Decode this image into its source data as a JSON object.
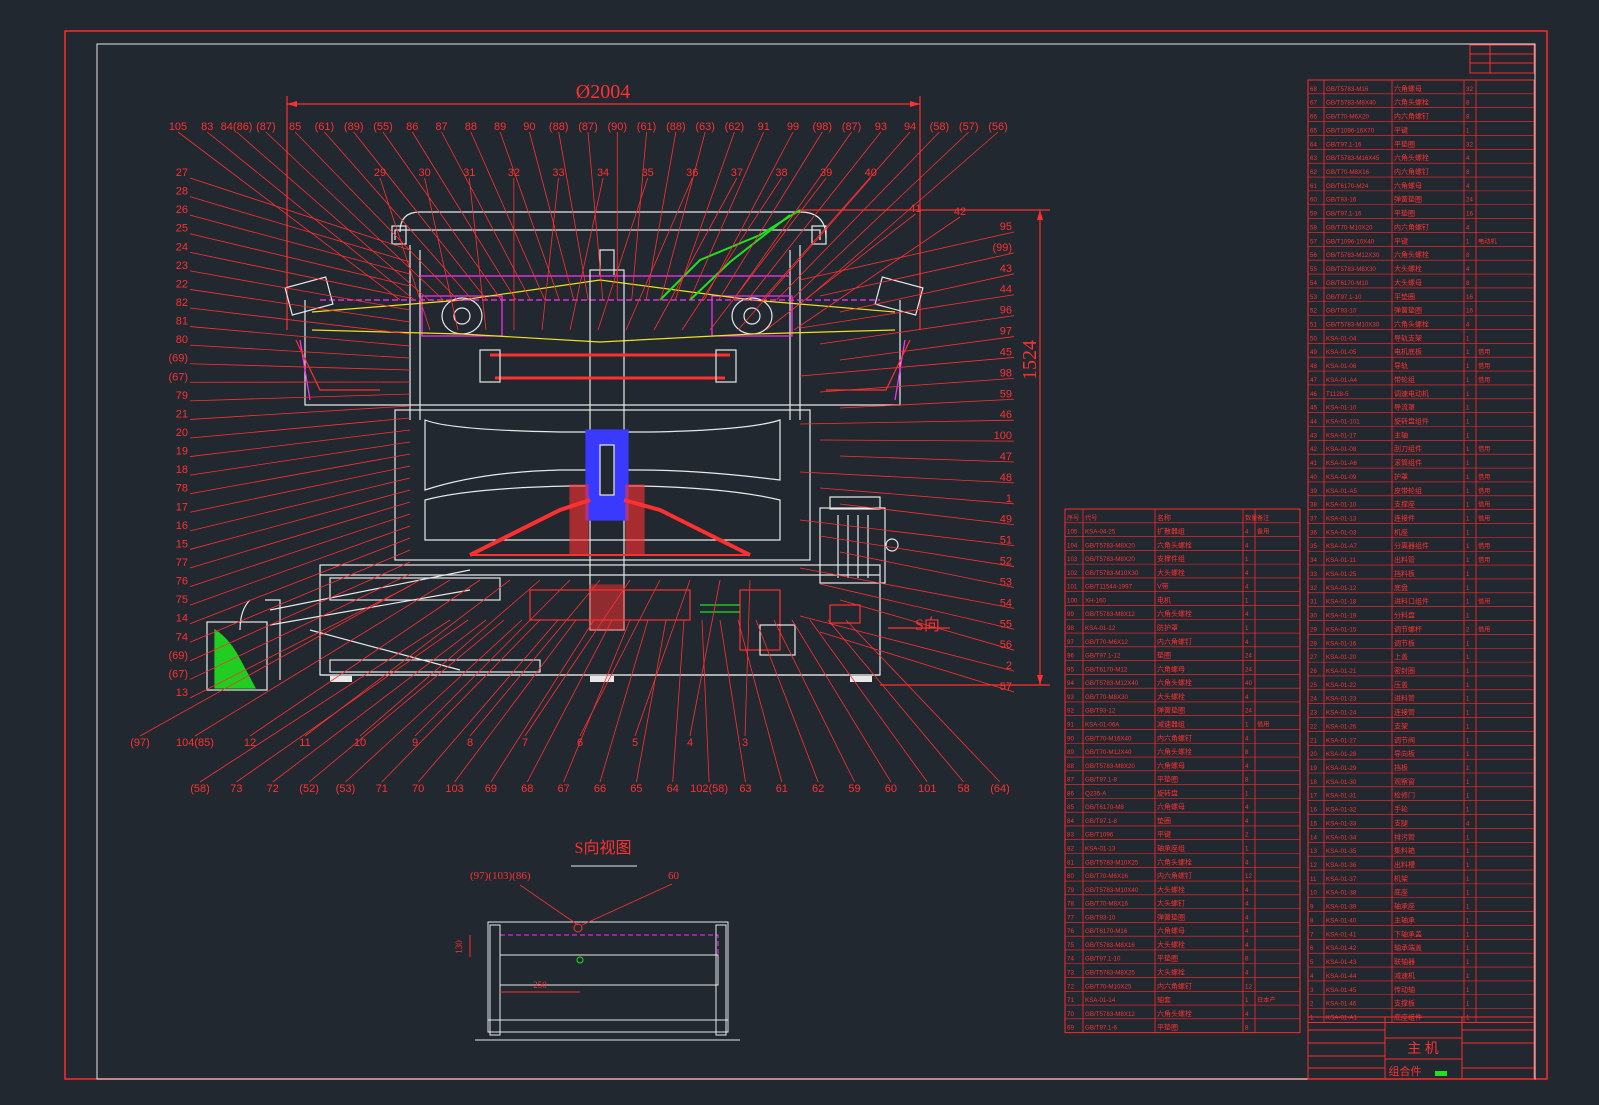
{
  "drawing": {
    "dimension_width": "Ø2004",
    "dimension_height": "1524",
    "section_marker": "S向",
    "view_title": "S向视图",
    "view_callouts": [
      "(97)(103)(86)",
      "60"
    ],
    "view_dim_height": "130",
    "view_dim_width": "250",
    "title_block_name": "主 机",
    "title_block_type": "组合件"
  },
  "callouts_top": [
    "105",
    "83",
    "84(86)",
    "(87)",
    "85",
    "(61)",
    "(89)",
    "(55)",
    "86",
    "87",
    "88",
    "89",
    "90",
    "(88)",
    "(87)",
    "(90)",
    "(61)",
    "(88)",
    "(63)",
    "(62)",
    "91",
    "99",
    "(98)",
    "(87)",
    "93",
    "94",
    "(58)",
    "(57)",
    "(56)"
  ],
  "callouts_upper_row": [
    "29",
    "30",
    "31",
    "32",
    "33",
    "34",
    "35",
    "36",
    "37",
    "38",
    "39",
    "40",
    "41",
    "42"
  ],
  "callouts_left": [
    "27",
    "28",
    "26",
    "25",
    "24",
    "23",
    "22",
    "82",
    "81",
    "80",
    "(69)",
    "(67)",
    "79",
    "21",
    "20",
    "19",
    "18",
    "78",
    "17",
    "16",
    "15",
    "77",
    "76",
    "75",
    "14",
    "74",
    "(69)",
    "(67)",
    "13"
  ],
  "callouts_right": [
    "95",
    "(99)",
    "43",
    "44",
    "96",
    "97",
    "45",
    "98",
    "59",
    "46",
    "100",
    "47",
    "48",
    "1",
    "49",
    "51",
    "52",
    "53",
    "54",
    "55",
    "56",
    "2",
    "57"
  ],
  "callouts_bottom": [
    "(97)",
    "104(85)",
    "12",
    "11",
    "10",
    "9",
    "8",
    "7",
    "6",
    "5",
    "4",
    "3",
    "(58)",
    "73",
    "72",
    "(52)",
    "(53)",
    "71",
    "70",
    "103",
    "69",
    "68",
    "67",
    "66",
    "65",
    "64",
    "102(58)",
    "63",
    "61",
    "62",
    "59",
    "60",
    "101",
    "58",
    "(64)"
  ],
  "parts_list_header": [
    "序号",
    "代号",
    "名称",
    "数量",
    "备注"
  ],
  "parts_list_mid": [
    [
      "105",
      "KSA-04-25",
      "扩散器组",
      "4",
      "备用"
    ],
    [
      "104",
      "GB/T5783-M8X20",
      "六角头螺栓",
      "4",
      ""
    ],
    [
      "103",
      "GB/T5783-M8X20",
      "支撑件组",
      "1",
      ""
    ],
    [
      "102",
      "GB/T5783-M10X30",
      "大头螺栓",
      "4",
      ""
    ],
    [
      "101",
      "GB/T11544-1997",
      "V带",
      "4",
      ""
    ],
    [
      "100",
      "XH-160",
      "电机",
      "1",
      ""
    ],
    [
      "99",
      "GB/T5783-M8X12",
      "六角头螺栓",
      "4",
      ""
    ],
    [
      "98",
      "KSA-01-12",
      "防护罩",
      "1",
      ""
    ],
    [
      "97",
      "GB/T70-M6X12",
      "内六角螺钉",
      "4",
      ""
    ],
    [
      "96",
      "GB/T97.1-12",
      "垫圈",
      "24",
      ""
    ],
    [
      "95",
      "GB/T6170-M12",
      "六角螺母",
      "24",
      ""
    ],
    [
      "94",
      "GB/T5783-M12X40",
      "六角头螺栓",
      "40",
      ""
    ],
    [
      "93",
      "GB/T70-M8X30",
      "大头螺栓",
      "4",
      ""
    ],
    [
      "92",
      "GB/T93-12",
      "弹簧垫圈",
      "24",
      ""
    ],
    [
      "91",
      "KSA-01-06A",
      "减速器组",
      "1",
      "借用"
    ],
    [
      "90",
      "GB/T70-M16X40",
      "内六角螺钉",
      "4",
      ""
    ],
    [
      "89",
      "GB/T70-M12X40",
      "六角头螺栓",
      "8",
      ""
    ],
    [
      "88",
      "GB/T5783-M8X20",
      "六角螺母",
      "4",
      ""
    ],
    [
      "87",
      "GB/T97.1-8",
      "平垫圈",
      "8",
      ""
    ],
    [
      "86",
      "Q235-A",
      "旋转盘",
      "1",
      ""
    ],
    [
      "85",
      "GB/T6170-M8",
      "六角螺母",
      "4",
      ""
    ],
    [
      "84",
      "GB/T97.1-8",
      "垫圈",
      "4",
      ""
    ],
    [
      "83",
      "GB/T1096",
      "平键",
      "2",
      ""
    ],
    [
      "82",
      "KSA-01-13",
      "轴承座组",
      "1",
      ""
    ],
    [
      "81",
      "GB/T5783-M10X25",
      "六角头螺栓",
      "4",
      ""
    ],
    [
      "80",
      "GB/T70-M6X16",
      "内六角螺钉",
      "12",
      ""
    ],
    [
      "79",
      "GB/T5783-M10X40",
      "大头螺栓",
      "4",
      ""
    ],
    [
      "78",
      "GB/T70-M8X16",
      "大头螺钉",
      "4",
      ""
    ],
    [
      "77",
      "GB/T93-10",
      "弹簧垫圈",
      "4",
      ""
    ],
    [
      "76",
      "GB/T6170-M16",
      "六角螺母",
      "4",
      ""
    ],
    [
      "75",
      "GB/T5783-M8X16",
      "大头螺栓",
      "4",
      ""
    ],
    [
      "74",
      "GB/T97.1-10",
      "平垫圈",
      "8",
      ""
    ],
    [
      "73",
      "GB/T5783-M8X25",
      "大头螺栓",
      "4",
      ""
    ],
    [
      "72",
      "GB/T70-M10X25",
      "内六角螺钉",
      "12",
      ""
    ],
    [
      "71",
      "KSA-01-14",
      "轴套",
      "1",
      "日本产"
    ],
    [
      "70",
      "GB/T5783-M8X12",
      "六角头螺栓",
      "4",
      ""
    ],
    [
      "69",
      "GB/T97.1-6",
      "平垫圈",
      "8",
      ""
    ]
  ],
  "parts_list_right": [
    [
      "68",
      "GB/T5783-M16",
      "六角螺母",
      "32",
      ""
    ],
    [
      "67",
      "GB/T5783-M8X40",
      "六角头螺栓",
      "8",
      ""
    ],
    [
      "66",
      "GB/T70-M6X20",
      "内六角螺钉",
      "8",
      ""
    ],
    [
      "65",
      "GB/T1096-16X70",
      "平键",
      "1",
      ""
    ],
    [
      "64",
      "GB/T97.1-16",
      "平垫圈",
      "32",
      ""
    ],
    [
      "63",
      "GB/T5783-M16X45",
      "六角头螺栓",
      "4",
      ""
    ],
    [
      "62",
      "GB/T70-M8X16",
      "内六角螺钉",
      "8",
      ""
    ],
    [
      "61",
      "GB/T6170-M24",
      "六角螺母",
      "4",
      ""
    ],
    [
      "60",
      "GB/T93-16",
      "弹簧垫圈",
      "24",
      ""
    ],
    [
      "59",
      "GB/T97.1-16",
      "平垫圈",
      "16",
      ""
    ],
    [
      "58",
      "GB/T70-M10X20",
      "内六角螺钉",
      "4",
      ""
    ],
    [
      "57",
      "GB/T1096-10X40",
      "平键",
      "1",
      "电动机"
    ],
    [
      "56",
      "GB/T5783-M12X30",
      "六角头螺栓",
      "8",
      ""
    ],
    [
      "55",
      "GB/T5783-M8X30",
      "大头螺栓",
      "4",
      ""
    ],
    [
      "54",
      "GB/T6170-M10",
      "大头螺母",
      "8",
      ""
    ],
    [
      "53",
      "GB/T97.1-10",
      "平垫圈",
      "16",
      ""
    ],
    [
      "52",
      "GB/T93-10",
      "弹簧垫圈",
      "16",
      ""
    ],
    [
      "51",
      "GB/T5783-M10X30",
      "六角头螺栓",
      "4",
      ""
    ],
    [
      "50",
      "KSA-01-04",
      "导轨支架",
      "1",
      ""
    ],
    [
      "49",
      "KSA-01-05",
      "电机底板",
      "1",
      "借用"
    ],
    [
      "48",
      "KSA-01-06",
      "导轨",
      "1",
      "借用"
    ],
    [
      "47",
      "KSA-01-A4",
      "带轮组",
      "1",
      "借用"
    ],
    [
      "46",
      "T1128-5",
      "调速电动机",
      "1",
      ""
    ],
    [
      "45",
      "KSA-01-10",
      "导流罩",
      "1",
      ""
    ],
    [
      "44",
      "KSA-01-101",
      "旋转盘组件",
      "1",
      ""
    ],
    [
      "43",
      "KSA-01-17",
      "主轴",
      "1",
      ""
    ],
    [
      "42",
      "KSA-01-08",
      "刮刀组件",
      "1",
      "借用"
    ],
    [
      "41",
      "KSA-01-A6",
      "滚筒组件",
      "1",
      ""
    ],
    [
      "40",
      "KSA-01-09",
      "护罩",
      "1",
      "借用"
    ],
    [
      "39",
      "KSA-01-A5",
      "皮带轮组",
      "1",
      "借用"
    ],
    [
      "38",
      "KSA-01-10",
      "支撑座",
      "1",
      "借用"
    ],
    [
      "37",
      "KSA-01-13",
      "连接件",
      "1",
      "借用"
    ],
    [
      "36",
      "KSA-01-03",
      "机座",
      "1",
      ""
    ],
    [
      "35",
      "KSA-01-A7",
      "分离器组件",
      "1",
      "借用"
    ],
    [
      "34",
      "KSA-01-11",
      "出料管",
      "1",
      "借用"
    ],
    [
      "33",
      "KSA-01-25",
      "挡料板",
      "1",
      ""
    ],
    [
      "32",
      "KSA-01-12",
      "底盘",
      "1",
      ""
    ],
    [
      "31",
      "KSA-01-18",
      "进料口组件",
      "1",
      "借用"
    ],
    [
      "30",
      "KSA-01-19",
      "分料盘",
      "1",
      ""
    ],
    [
      "29",
      "KSA-01-15",
      "调节螺杆",
      "2",
      "借用"
    ],
    [
      "28",
      "KSA-01-16",
      "调节板",
      "1",
      ""
    ],
    [
      "27",
      "KSA-01-20",
      "上盖",
      "1",
      ""
    ],
    [
      "26",
      "KSA-01-21",
      "密封圈",
      "1",
      ""
    ],
    [
      "25",
      "KSA-01-22",
      "压盖",
      "1",
      ""
    ],
    [
      "24",
      "KSA-01-23",
      "进料管",
      "1",
      ""
    ],
    [
      "23",
      "KSA-01-24",
      "连接管",
      "1",
      ""
    ],
    [
      "22",
      "KSA-01-26",
      "支架",
      "1",
      ""
    ],
    [
      "21",
      "KSA-01-27",
      "调节阀",
      "1",
      ""
    ],
    [
      "20",
      "KSA-01-28",
      "导向板",
      "1",
      ""
    ],
    [
      "19",
      "KSA-01-29",
      "挡板",
      "1",
      ""
    ],
    [
      "18",
      "KSA-01-30",
      "观察窗",
      "1",
      ""
    ],
    [
      "17",
      "KSA-01-31",
      "检修门",
      "1",
      ""
    ],
    [
      "16",
      "KSA-01-32",
      "手轮",
      "1",
      ""
    ],
    [
      "15",
      "KSA-01-33",
      "支腿",
      "4",
      ""
    ],
    [
      "14",
      "KSA-01-34",
      "排污管",
      "1",
      ""
    ],
    [
      "13",
      "KSA-01-35",
      "集料箱",
      "1",
      ""
    ],
    [
      "12",
      "KSA-01-36",
      "出料槽",
      "1",
      ""
    ],
    [
      "11",
      "KSA-01-37",
      "机架",
      "1",
      ""
    ],
    [
      "10",
      "KSA-01-38",
      "底座",
      "1",
      ""
    ],
    [
      "9",
      "KSA-01-39",
      "轴承座",
      "1",
      ""
    ],
    [
      "8",
      "KSA-01-40",
      "主轴承",
      "1",
      ""
    ],
    [
      "7",
      "KSA-01-41",
      "下轴承盖",
      "1",
      ""
    ],
    [
      "6",
      "KSA-01-42",
      "轴承端盖",
      "1",
      ""
    ],
    [
      "5",
      "KSA-01-43",
      "联轴器",
      "1",
      ""
    ],
    [
      "4",
      "KSA-01-44",
      "减速机",
      "1",
      ""
    ],
    [
      "3",
      "KSA-01-45",
      "传动轴",
      "1",
      ""
    ],
    [
      "2",
      "KSA-01-46",
      "支撑板",
      "1",
      ""
    ],
    [
      "1",
      "KSA-01-A1",
      "底座组件",
      "1",
      ""
    ]
  ],
  "colors": {
    "background": "#212830",
    "frame": "#ff2a2a",
    "outline": "#e8e8e8",
    "section": "#3a3aff",
    "magenta": "#ff30ff",
    "yellow": "#f0e020",
    "green": "#20e020"
  }
}
